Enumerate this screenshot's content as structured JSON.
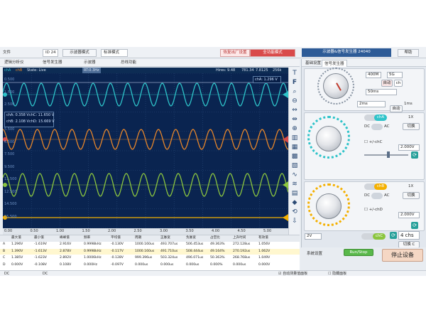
{
  "toolbar": {
    "file_menu": "文件",
    "device_select": "ID 24",
    "mode_button": "示波器模式",
    "mode_select": "标准模式",
    "factory_button": "恢复出厂设置",
    "safe_mode_button": "全功能模式",
    "panel_title": "示波器&信号发生器 24040",
    "help_button": "帮助"
  },
  "tabs": [
    "逻辑分析仪",
    "信号发生器",
    "示波器",
    "总线功能"
  ],
  "scope": {
    "channels": [
      "chA",
      "chB"
    ],
    "state_label": "State: Live",
    "mode_tag": "RT:0.3Hz",
    "stats": "Hires: 9.48",
    "stats_values": [
      "781.34",
      "7.8125",
      "256k"
    ],
    "info_a": "chA: 0.358 V",
    "info_b": "chB: 2.108 V",
    "info_dc": "chC: 11.650 V",
    "info_dd": "chD: 15.669 V",
    "marker_a": "chA: 1.296 V",
    "y_labels": [
      "0.500",
      "1.500",
      "2.500",
      "3.500",
      "5.500",
      "6.500",
      "7.500",
      "9.500",
      "11.500",
      "12.500",
      "14.500",
      "15.500"
    ],
    "x_labels": [
      "0.00",
      "0.50",
      "1.00",
      "1.50",
      "2.00",
      "2.50",
      "3.00",
      "3.50",
      "4.00",
      "4.50",
      "5.00",
      "ms"
    ]
  },
  "measure": {
    "headers": [
      "最大值",
      "最小值",
      "峰峰值",
      "频率",
      "平均值",
      "周期",
      "正脉宽",
      "负脉宽",
      "占空比",
      "上升时间",
      "有效值"
    ],
    "rows": [
      {
        "label": "A",
        "cells": [
          "1.296V",
          "-1.619V",
          "2.916V",
          "0.9998kHz",
          "-0.130V",
          "1000.160us",
          "493.707us",
          "506.453us",
          "49.363%",
          "272.128us",
          "1.056V"
        ]
      },
      {
        "label": "B",
        "cells": [
          "1.390V",
          "-1.613V",
          "2.878V",
          "0.9998kHz",
          "-0.117V",
          "1000.160us",
          "491.710us",
          "508.444us",
          "49.164%",
          "270.192us",
          "1.062V"
        ]
      },
      {
        "label": "C",
        "cells": [
          "1.385V",
          "-1.623V",
          "2.892V",
          "1.0006kHz",
          "-0.128V",
          "999.396us",
          "503.324us",
          "496.071us",
          "50.363%",
          "268.768us",
          "1.049V"
        ]
      },
      {
        "label": "D",
        "cells": [
          "0.000V",
          "-0.108V",
          "0.108V",
          "0.000Hz",
          "-0.097V",
          "0.000us",
          "0.000us",
          "0.000us",
          "0.000%",
          "0.000us",
          "0.000V"
        ]
      }
    ]
  },
  "status": {
    "left": [
      "DC",
      "DC"
    ],
    "auto_measure": "自动测量值面板",
    "hide_panel": "隐藏面板"
  },
  "rpanel": {
    "tabs": [
      "基础设置",
      "信号发生器"
    ],
    "sample_fields": [
      "400M",
      "5G"
    ],
    "timebase_label": "自动",
    "timebase_value": "50ms",
    "time_select": "2ms",
    "time_right": "1ms",
    "auto_button": "自动",
    "chA_pill": "chA",
    "chB_pill": "chB",
    "chC_pill": "chC",
    "x1": "1X",
    "dc_label": "DC",
    "ac_label": "AC",
    "couple_a": "+/-chC",
    "couple_b": "+/-chD",
    "volts_a": "2.000V",
    "volts_b": "2.000V",
    "switch_button": "切换",
    "select_volt": "2V",
    "chs_count": "4 chs",
    "switch_c": "切换 C",
    "bottom_tab": "系统设置",
    "run_stop": "Run/Stop",
    "stop_button": "停止设备"
  },
  "colors": {
    "chA": "#2ec3c9",
    "chB": "#e7862a",
    "chC": "#8bc53f",
    "chD": "#f4b000",
    "scope_bg": "#0a2450",
    "accent_red": "#d94a4a",
    "run_green": "#59b84a"
  }
}
